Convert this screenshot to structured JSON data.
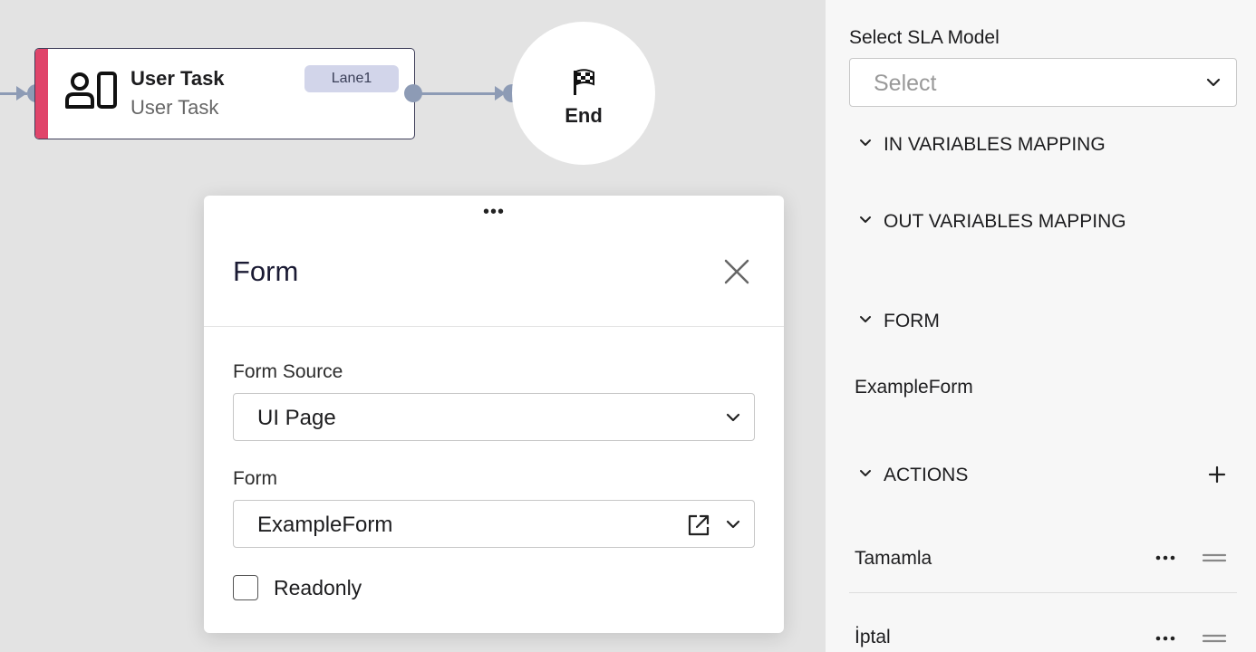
{
  "canvas": {
    "task_node": {
      "title": "User Task",
      "subtitle": "User Task",
      "lane": "Lane1",
      "icon": "user-task-icon",
      "stripe_color": "#e0446a"
    },
    "end_node": {
      "label": "End",
      "icon": "checkered-flag-icon"
    },
    "edge_color": "#8d9bb5"
  },
  "dialog": {
    "title": "Form",
    "form_source": {
      "label": "Form Source",
      "value": "UI Page"
    },
    "form": {
      "label": "Form",
      "value": "ExampleForm"
    },
    "readonly": {
      "label": "Readonly",
      "checked": false
    }
  },
  "panel": {
    "sla": {
      "label": "Select SLA Model",
      "placeholder": "Select"
    },
    "sections": {
      "in_vars": "IN VARIABLES MAPPING",
      "out_vars": "OUT VARIABLES MAPPING",
      "form": "FORM",
      "actions": "ACTIONS"
    },
    "form_value": "ExampleForm",
    "actions": [
      {
        "label": "Tamamla"
      },
      {
        "label": "İptal"
      }
    ]
  }
}
